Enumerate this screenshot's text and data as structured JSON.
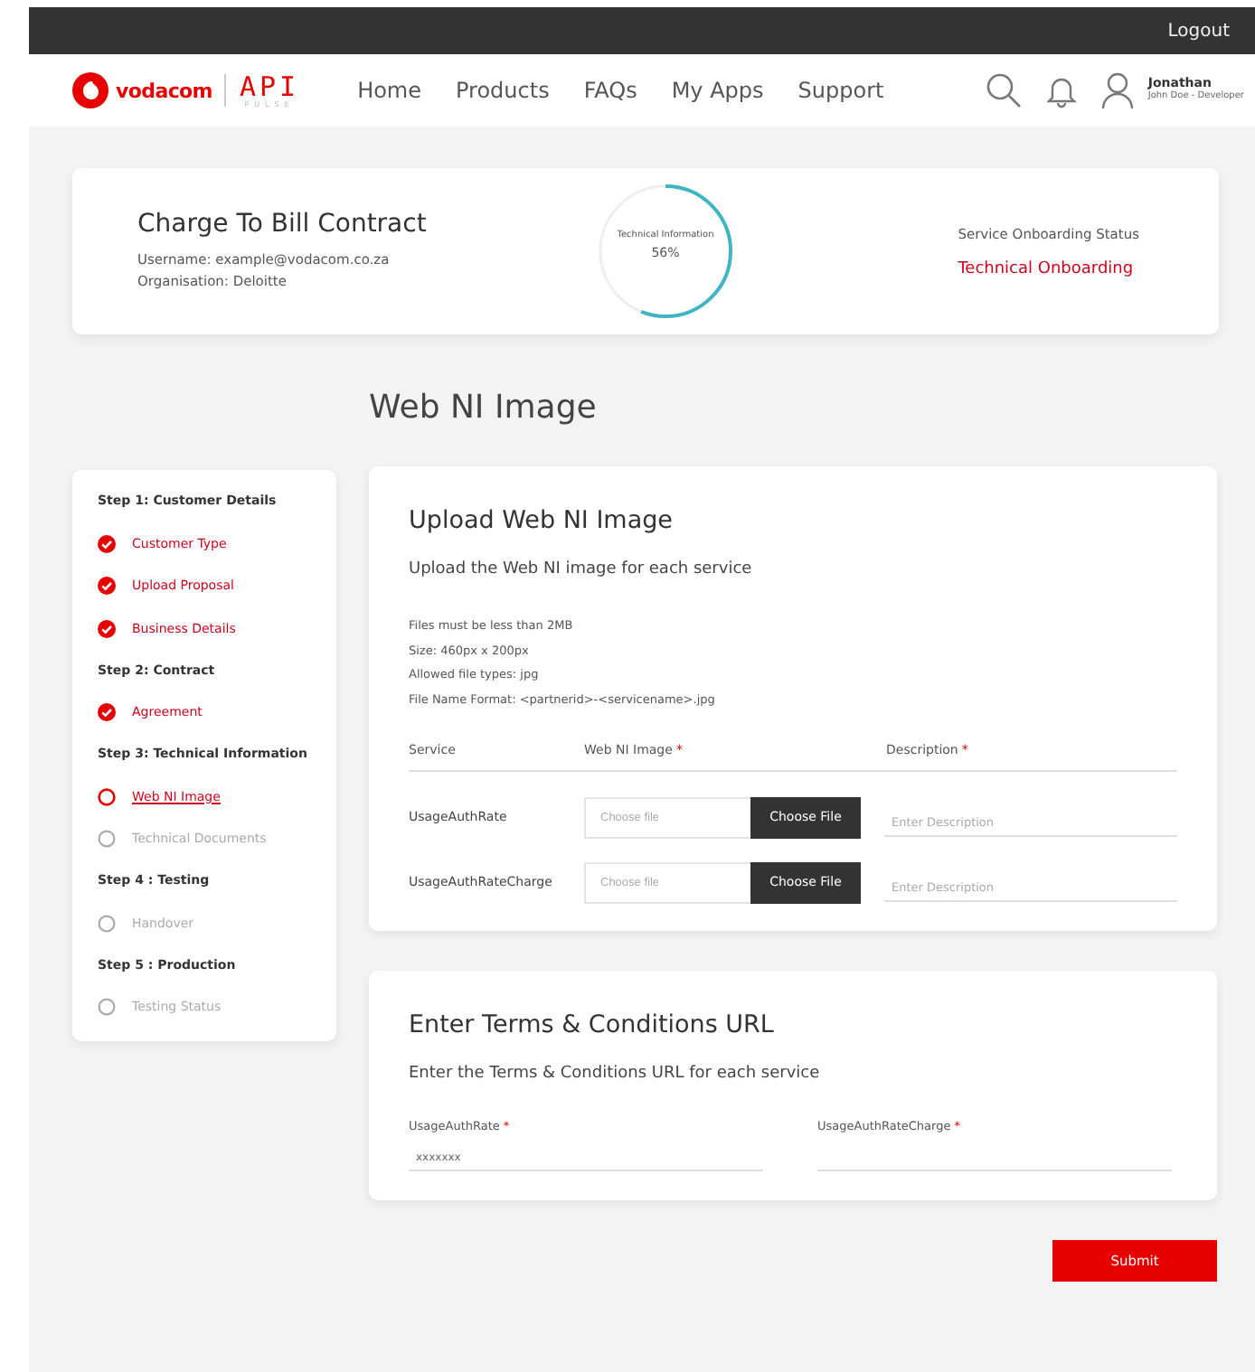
{
  "top_bar": {
    "logout": "Logout"
  },
  "nav": {
    "logo": {
      "brand": "vodacom",
      "product": "API",
      "subtitle": "PULSE"
    },
    "links": [
      "Home",
      "Products",
      "FAQs",
      "My Apps",
      "Support"
    ],
    "user": {
      "name": "Jonathan",
      "role": "John Doe - Developer"
    }
  },
  "contract": {
    "title": "Charge To Bill Contract",
    "username": "Username: example@vodacom.co.za",
    "organisation": "Organisation: Deloitte",
    "progress": {
      "label": "Technical Information",
      "reading": "56%",
      "level": 0.56
    },
    "status_label": "Service Onboarding Status",
    "status": "Technical Onboarding"
  },
  "page_title": "Web NI Image",
  "steps": [
    {
      "title": "Step 1: Customer Details",
      "items": [
        {
          "label": "Customer Type",
          "completed": true,
          "selected": false
        },
        {
          "label": "Upload Proposal",
          "completed": true,
          "selected": false
        },
        {
          "label": "Business Details",
          "completed": true,
          "selected": false
        }
      ]
    },
    {
      "title": "Step 2: Contract",
      "items": [
        {
          "label": "Agreement",
          "completed": true,
          "selected": false
        }
      ]
    },
    {
      "title": "Step 3: Technical Information",
      "items": [
        {
          "label": "Web NI Image",
          "completed": false,
          "selected": true
        },
        {
          "label": "Technical Documents",
          "completed": false,
          "selected": false
        }
      ]
    },
    {
      "title": "Step 4 : Testing",
      "items": [
        {
          "label": "Handover",
          "completed": false,
          "selected": false
        }
      ]
    },
    {
      "title": "Step 5 : Production",
      "items": [
        {
          "label": "Testing Status",
          "completed": false,
          "selected": false
        }
      ]
    }
  ],
  "upload": {
    "title": "Upload Web NI Image",
    "subtitle": "Upload the Web NI image for each service",
    "rules": [
      "Files must be less than 2MB",
      "Size: 460px x 200px",
      "Allowed file types: jpg",
      "File Name Format: <partnerid>-<servicename>.jpg"
    ],
    "columns": [
      {
        "label": "Service"
      },
      {
        "label": "Web NI Image",
        "required_mark": "*"
      },
      {
        "label": "Description",
        "required_mark": "*"
      }
    ],
    "rows": [
      {
        "service": "UsageAuthRate",
        "file_placeholder": "Choose file",
        "button": "Choose File",
        "description_placeholder": "Enter Description"
      },
      {
        "service": "UsageAuthRateCharge",
        "file_placeholder": "Choose file",
        "button": "Choose File",
        "description_placeholder": "Enter Description"
      }
    ]
  },
  "terms": {
    "title": "Enter Terms & Conditions URL",
    "subtitle": "Enter the Terms & Conditions URL for each service",
    "fields": [
      {
        "label": "UsageAuthRate",
        "required_mark": "*",
        "value": "xxxxxxx"
      },
      {
        "label": "UsageAuthRateCharge",
        "required_mark": "*"
      }
    ]
  },
  "submit": "Submit"
}
